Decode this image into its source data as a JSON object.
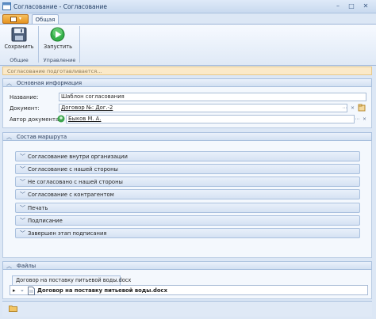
{
  "window": {
    "title": "Согласование - Согласование"
  },
  "ribbon": {
    "tab_label": "Общая",
    "save_label": "Сохранить",
    "group_general": "Общие",
    "start_label": "Запустить",
    "group_manage": "Управление"
  },
  "status": {
    "message": "Согласование подготавливается..."
  },
  "basic_info": {
    "header": "Основная информация",
    "name_label": "Название:",
    "name_value": "Шаблон согласования",
    "document_label": "Документ:",
    "document_value": "Договор №: Дог.-2",
    "author_label": "Автор документа:",
    "author_value": "Быков М. А."
  },
  "route": {
    "header": "Состав маршрута",
    "items": [
      {
        "label": "Согласование внутри организации"
      },
      {
        "label": "Согласование с нашей стороны"
      },
      {
        "label": "Не согласовано с нашей стороны"
      },
      {
        "label": "Согласование с контрагентом"
      },
      {
        "label": "Печать"
      },
      {
        "label": "Подписание"
      },
      {
        "label": "Завершен этап подписания"
      }
    ]
  },
  "files": {
    "header": "Файлы",
    "tab_label": "Договор на поставку питьевой воды.docx",
    "row_name": "Договор на поставку питьевой воды.docx"
  },
  "icons": {
    "save": "floppy-disk-icon",
    "start": "play-icon",
    "author": "user-icon",
    "file": "document-icon",
    "folder": "folder-icon"
  },
  "colors": {
    "accent": "#e69420",
    "status_bg": "#fbe9c8",
    "ribbon": "#dfe9f6"
  }
}
